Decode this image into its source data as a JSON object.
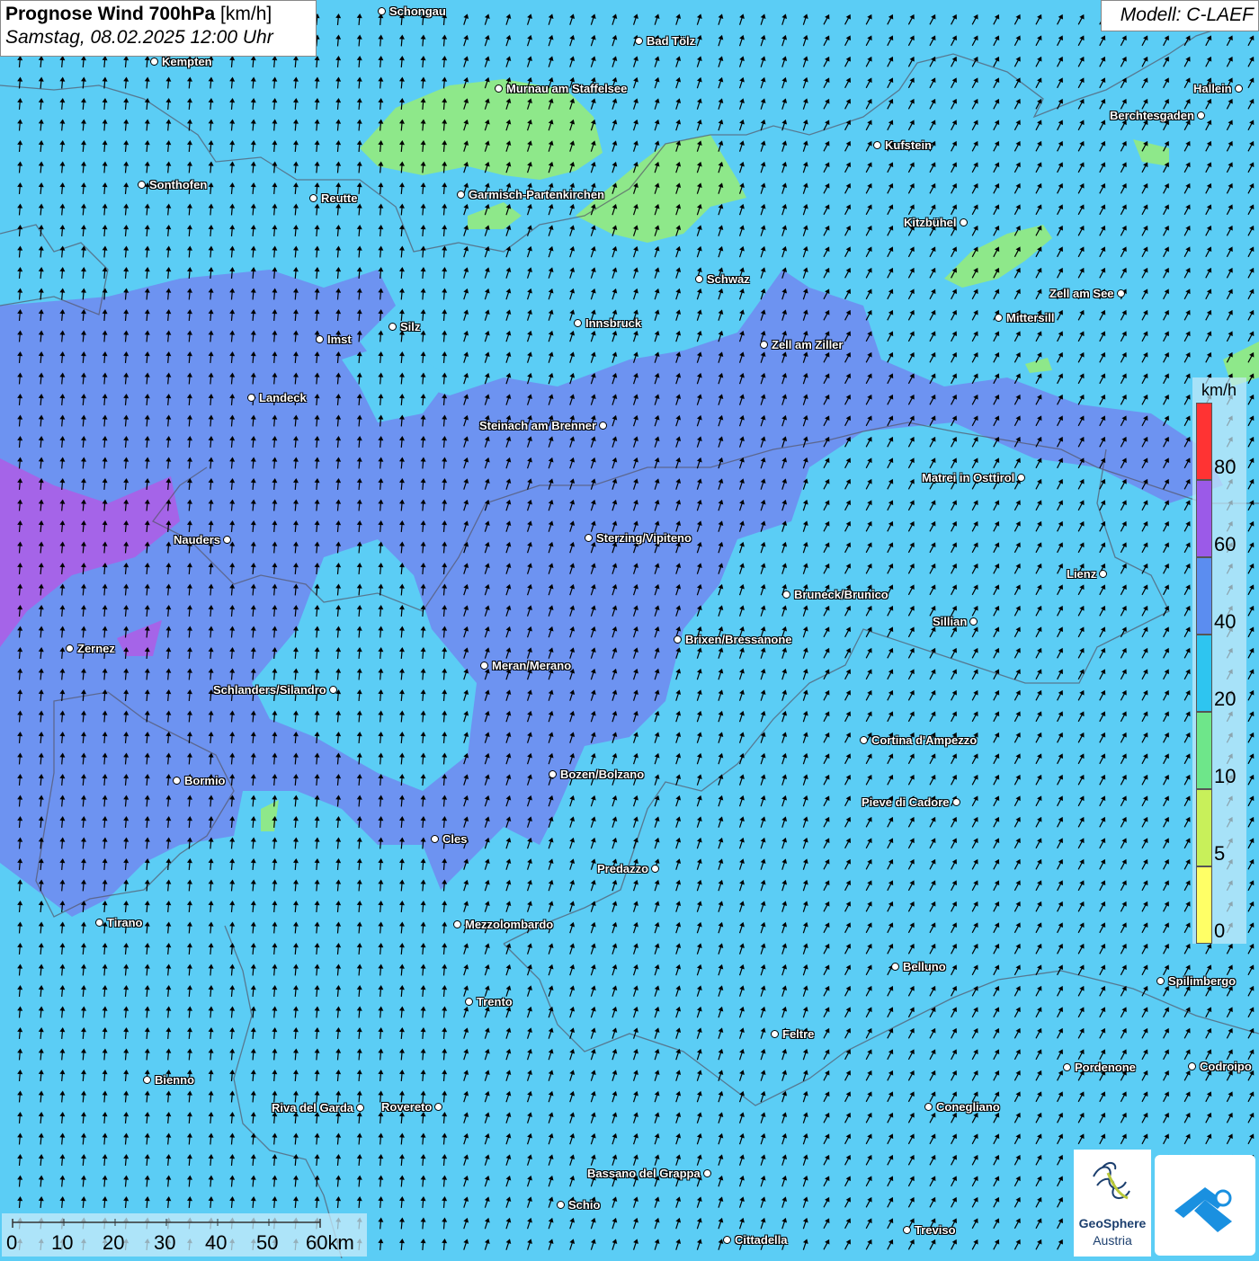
{
  "header": {
    "title_bold": "Prognose Wind 700hPa",
    "title_unit": "[km/h]",
    "subtitle": "Samstag, 08.02.2025 12:00 Uhr",
    "model": "Modell: C-LAEF"
  },
  "legend": {
    "unit": "km/h",
    "labels": [
      "80",
      "60",
      "40",
      "20",
      "10",
      "5",
      "0"
    ],
    "colors": [
      "#ff3333",
      "#9b5ae8",
      "#5b8df0",
      "#2ec5f0",
      "#6ee68a",
      "#c8f05a",
      "#ffff66"
    ]
  },
  "scale_bar": {
    "labels": [
      "0",
      "10",
      "20",
      "30",
      "40",
      "50",
      "60km"
    ]
  },
  "logo": {
    "name": "GeoSphere",
    "sub": "Austria"
  },
  "cities": [
    {
      "name": "Schongau"
    },
    {
      "name": "Bad Tölz"
    },
    {
      "name": "Kempten"
    },
    {
      "name": "Murnau am Staffelsee"
    },
    {
      "name": "Hallein"
    },
    {
      "name": "Berchtesgaden"
    },
    {
      "name": "Kufstein"
    },
    {
      "name": "Sonthofen"
    },
    {
      "name": "Reutte"
    },
    {
      "name": "Garmisch-Partenkirchen"
    },
    {
      "name": "Kitzbühel"
    },
    {
      "name": "Schwaz"
    },
    {
      "name": "Zell am See"
    },
    {
      "name": "Mittersill"
    },
    {
      "name": "Imst"
    },
    {
      "name": "Silz"
    },
    {
      "name": "Innsbruck"
    },
    {
      "name": "Zell am Ziller"
    },
    {
      "name": "Landeck"
    },
    {
      "name": "Steinach am Brenner"
    },
    {
      "name": "Matrei in Osttirol"
    },
    {
      "name": "Nauders"
    },
    {
      "name": "Sterzing/Vipiteno"
    },
    {
      "name": "Lienz"
    },
    {
      "name": "Bruneck/Brunico"
    },
    {
      "name": "Sillian"
    },
    {
      "name": "Brixen/Bressanone"
    },
    {
      "name": "Zernez"
    },
    {
      "name": "Meran/Merano"
    },
    {
      "name": "Schlanders/Silandro"
    },
    {
      "name": "Cortina d'Ampezzo"
    },
    {
      "name": "Bozen/Bolzano"
    },
    {
      "name": "Bormio"
    },
    {
      "name": "Pieve di Cadore"
    },
    {
      "name": "Cles"
    },
    {
      "name": "Predazzo"
    },
    {
      "name": "Tirano"
    },
    {
      "name": "Mezzolombardo"
    },
    {
      "name": "Belluno"
    },
    {
      "name": "Spilimbergo"
    },
    {
      "name": "Trento"
    },
    {
      "name": "Feltre"
    },
    {
      "name": "Pordenone"
    },
    {
      "name": "Codroipo"
    },
    {
      "name": "Bienno"
    },
    {
      "name": "Riva del Garda"
    },
    {
      "name": "Rovereto"
    },
    {
      "name": "Conegliano"
    },
    {
      "name": "Bassano del Grappa"
    },
    {
      "name": "Schio"
    },
    {
      "name": "Treviso"
    },
    {
      "name": "Cittadella"
    }
  ]
}
